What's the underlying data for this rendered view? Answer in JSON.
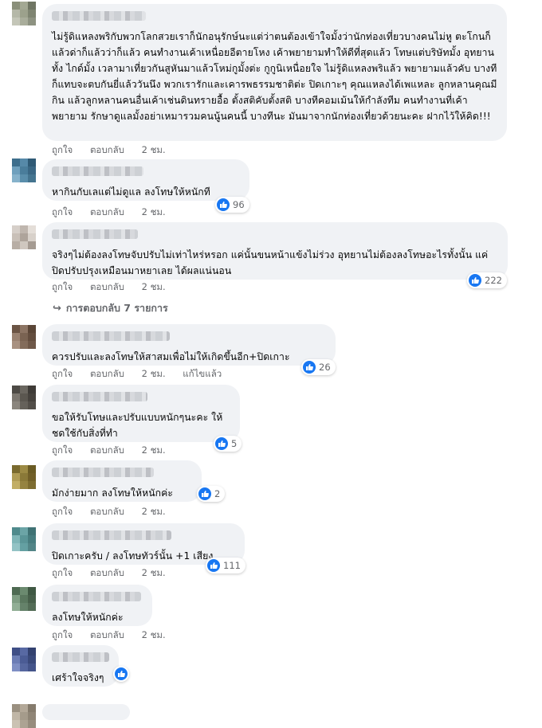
{
  "comments": [
    {
      "text": "ไม่รู้ดิแหลงพริกับพวกโลกสวยเราก็นักอนุรักษ์นะแต่ว่าตนต้องเข้าใจมั้งว่านักท่องเที่ยวบางคนไม่หู ตะโกนก็แล้วด่าก็แล้วว่าก็แล้ว คนทำงานเค้าเหนื่อยอีตายโหง เค้าพยายามทำให้ดีที่สุดแล้ว โทษแต่บริษัทมั้ง อุทยานทั้ง ไกด์มั้ง เวลามาเที่ยวกันสูหันมาแล้วโหม่กูมั้งต่ะ กูกูนิเหนื่อยใจ ไม่รู้ดิแหลงพริแล้ว พยายามแล้วคับ บางทีก็แทบจะตบกันยี่แล้ววันนึง พวกเรารักและเคารพธรรมชาติต่ะ ปิดเกาะๆ คุณแหลงได้เพแหละ ลูกหลานคุณมีกิน แล้วลูกหลานคนอื่นเค้าเช่นดินทรายอื้อ ตั้งสติคับตั้งสติ บางทีคอมเม้นให้กำลังทีม คนทำงานที่เค้าพยายาม รักษาดูแลมั้งอย่าเหมารวมคนนู้นคนนี้ บางทีนะ มันมาจากนักท่องเที่ยวด้วยนะคะ ฝากไว้ให้คิด!!!",
      "like": "ถูกใจ",
      "reply": "ตอบกลับ",
      "time": "2 ชม.",
      "edited": "",
      "reactions": ""
    },
    {
      "text": "หากินกับเลแต่ไม่ดูแล ลงโทษให้หนักที",
      "like": "ถูกใจ",
      "reply": "ตอบกลับ",
      "time": "2 ชม.",
      "edited": "",
      "reactions": "96"
    },
    {
      "text": "จริงๆไม่ต้องลงโทษจับปรับไม่เท่าไหร่หรอก แค่นั้นขนหน้าแข้งไม่ร่วง อุทยานไม่ต้องลงโทษอะไรทั้งนั้น แค่ปิดปรับปรุงเหมือนมาหยาเลย ได้ผลแน่นอน",
      "like": "ถูกใจ",
      "reply": "ตอบกลับ",
      "time": "2 ชม.",
      "edited": "",
      "reactions": "222"
    },
    {
      "text": "ควรปรับและลงโทษให้สาสมเพื่อไม่ให้เกิดขึ้นอีก+ปิดเกาะ",
      "like": "ถูกใจ",
      "reply": "ตอบกลับ",
      "time": "2 ชม.",
      "edited": "แก้ไขแล้ว",
      "reactions": "26"
    },
    {
      "text": "ขอให้รับโทษและปรับแบบหนักๆนะคะ ให้ชดใช้กับสิ่งที่ทำ",
      "like": "ถูกใจ",
      "reply": "ตอบกลับ",
      "time": "2 ชม.",
      "edited": "",
      "reactions": "5"
    },
    {
      "text": "มักง่ายมาก ลงโทษให้หนักค่ะ",
      "like": "ถูกใจ",
      "reply": "ตอบกลับ",
      "time": "2 ชม.",
      "edited": "",
      "reactions": "2"
    },
    {
      "text": "ปิดเกาะครับ / ลงโทษทัวร์นั้น +1 เสียง",
      "like": "ถูกใจ",
      "reply": "ตอบกลับ",
      "time": "2 ชม.",
      "edited": "",
      "reactions": "111"
    },
    {
      "text": "ลงโทษให้หนักค่ะ",
      "like": "ถูกใจ",
      "reply": "ตอบกลับ",
      "time": "2 ชม.",
      "edited": "",
      "reactions": ""
    },
    {
      "text": "เศร้าใจจริงๆ",
      "like": "",
      "reply": "",
      "time": "",
      "edited": "",
      "reactions": ""
    }
  ],
  "replies_link": "การตอบกลับ 7 รายการ",
  "icons": {
    "reaction": "like-thumb-icon",
    "reply_arrow": "reply-arrow-icon"
  },
  "colors": {
    "bubble": "#f0f2f5",
    "meta_text": "#65676b",
    "like_blue": "#1877f2"
  }
}
